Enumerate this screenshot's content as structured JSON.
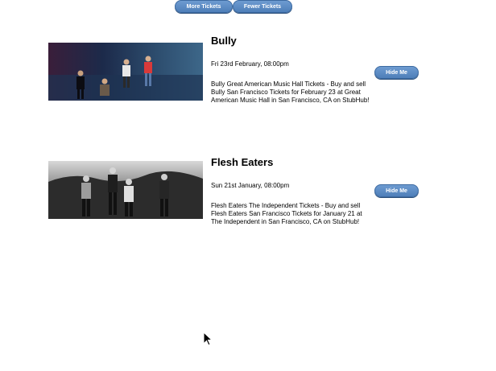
{
  "controls": {
    "more_label": "More Tickets",
    "fewer_label": "Fewer Tickets"
  },
  "events": [
    {
      "title": "Bully",
      "date": "Fri 23rd February, 08:00pm",
      "description": "Bully Great American Music Hall Tickets - Buy and sell Bully San Francisco Tickets for February 23 at Great American Music Hall in San Francisco, CA on StubHub!",
      "hide_label": "Hide Me",
      "image_icon": "band-photo-color"
    },
    {
      "title": "Flesh Eaters",
      "date": "Sun 21st January, 08:00pm",
      "description": "Flesh Eaters The Independent Tickets - Buy and sell Flesh Eaters San Francisco Tickets for January 21 at The Independent in San Francisco, CA on StubHub!",
      "hide_label": "Hide Me",
      "image_icon": "band-photo-bw"
    }
  ],
  "colors": {
    "button_top": "#6d9bd1",
    "button_bottom": "#4f7fb9",
    "button_border": "#3c6aa1"
  },
  "cursor_icon": "mouse-pointer-icon"
}
